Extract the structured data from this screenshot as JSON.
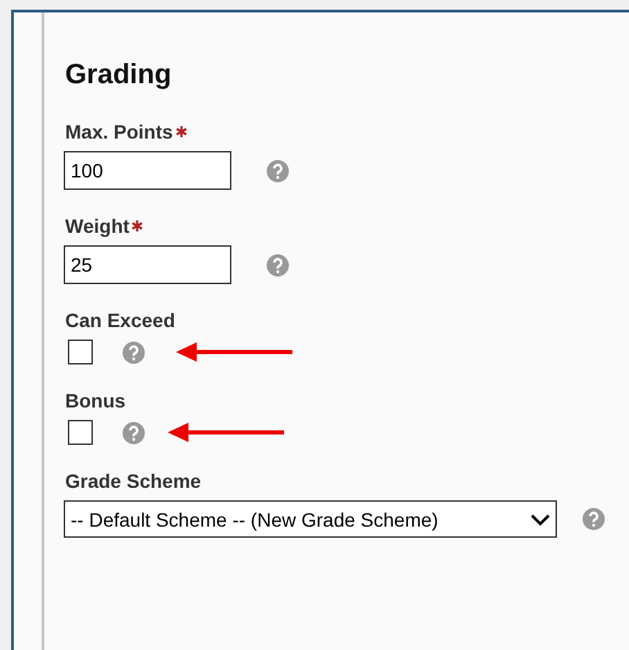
{
  "section": {
    "title": "Grading"
  },
  "fields": [
    {
      "kind": "text",
      "label": "Max. Points",
      "required": true,
      "value": "100",
      "annotated": false
    },
    {
      "kind": "text",
      "label": "Weight",
      "required": true,
      "value": "25",
      "annotated": false
    },
    {
      "kind": "checkbox",
      "label": "Can Exceed",
      "required": false,
      "checked": false,
      "annotated": true
    },
    {
      "kind": "checkbox",
      "label": "Bonus",
      "required": false,
      "checked": false,
      "annotated": true
    },
    {
      "kind": "select",
      "label": "Grade Scheme",
      "required": false,
      "value": "-- Default Scheme -- (New Grade Scheme)",
      "annotated": false
    }
  ]
}
